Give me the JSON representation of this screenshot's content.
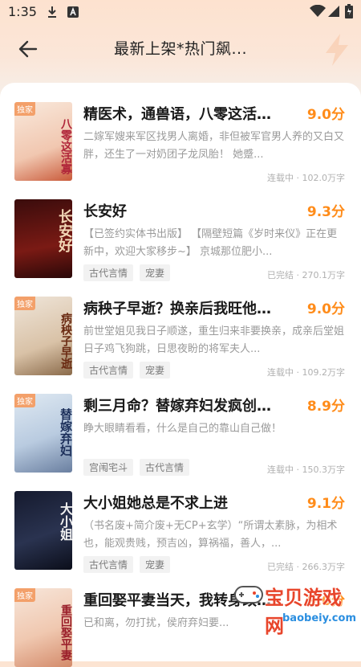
{
  "status_bar": {
    "time": "1:35",
    "icons": [
      "download-icon",
      "notification-a-icon",
      "wifi-icon",
      "battery-icon"
    ]
  },
  "header": {
    "title": "最新上架*热门飙...",
    "back_icon": "back-arrow-icon"
  },
  "colors": {
    "accent": "#ff8c1a",
    "header_bg": "#fde2cf",
    "tag_bg": "#f2f2f2"
  },
  "books": [
    {
      "cover_tag": "独家",
      "cover_text": "八零这活寡",
      "title": "精医术，通兽语，八零这活寡...",
      "score": "9.0分",
      "desc": "二嫁军嫂来军区找男人离婚，非但被军官男人养的又白又胖，还生了一对奶团子龙凤胎！ 她蹙...",
      "tags": [],
      "meta": "连载中 · 102.0万字"
    },
    {
      "cover_tag": "",
      "cover_text": "长安好",
      "title": "长安好",
      "score": "9.3分",
      "desc": "【已签约实体书出版】 【隔壁短篇《岁时来仪》正在更新中，欢迎大家移步~】 京城那位肥小...",
      "tags": [
        "古代言情",
        "宠妻"
      ],
      "meta": "已完结 · 270.1万字"
    },
    {
      "cover_tag": "独家",
      "cover_text": "病秧子早逝",
      "title": "病秧子早逝？换亲后我旺他全...",
      "score": "9.0分",
      "desc": "前世堂姐见我日子顺遂，重生归来非要换亲，成亲后堂姐日子鸡飞狗跳，日思夜盼的将军夫人...",
      "tags": [
        "古代言情",
        "宠妻"
      ],
      "meta": "连载中 · 109.2万字"
    },
    {
      "cover_tag": "独家",
      "cover_text": "替嫁弃妇",
      "title": "剩三月命？替嫁弃妇发疯创死...",
      "score": "8.9分",
      "desc": "睁大眼睛看看，什么是自己的靠山自己做！",
      "tags": [
        "宫闱宅斗",
        "古代言情"
      ],
      "meta": "连载中 · 150.3万字"
    },
    {
      "cover_tag": "",
      "cover_text": "大小姐",
      "title": "大小姐她总是不求上进",
      "score": "9.1分",
      "desc": "（书名废+简介废+无CP+玄学）“所谓太素脉，为相术也，能观贵贱，预吉凶，算祸福，善人，...",
      "tags": [
        "古代言情",
        "宠妻"
      ],
      "meta": "已完结 · 266.3万字"
    },
    {
      "cover_tag": "独家",
      "cover_text": "重回娶平妻",
      "title": "重回娶平妻当天，我转身改嫁...",
      "score": "9.0分",
      "desc": "已和离，勿打扰，侯府弃妇要...",
      "tags": [],
      "meta": ""
    }
  ],
  "watermark": {
    "text": "宝贝游戏网",
    "url": "baobeiy.com"
  }
}
